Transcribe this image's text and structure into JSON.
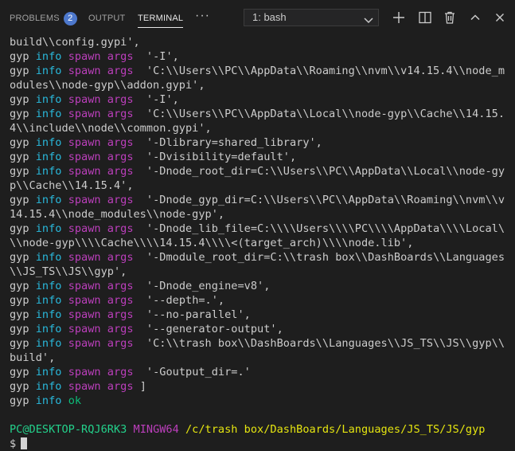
{
  "tabs": {
    "problems": "PROBLEMS",
    "problems_count": "2",
    "output": "OUTPUT",
    "terminal": "TERMINAL",
    "more": "···"
  },
  "terminal_select": {
    "value": "1: bash"
  },
  "icons": [
    "plus-icon",
    "split-icon",
    "trash-icon",
    "chevron-up-icon",
    "close-icon",
    "chevron-down-icon"
  ],
  "colors": {
    "background": "#1e1e1e",
    "info": "#29b8db",
    "spawn_args": "#bc3fbc",
    "ok": "#0dbc79",
    "prompt_user": "#23d18b",
    "prompt_env": "#bc3fbc",
    "prompt_path": "#e5e510",
    "badge": "#4d78cc"
  },
  "lines": [
    {
      "type": "plain",
      "text": "build\\\\config.gypi',"
    },
    {
      "type": "spawn",
      "arg": "  '-I',"
    },
    {
      "type": "spawn",
      "arg": "  'C:\\\\Users\\\\PC\\\\AppData\\\\Roaming\\\\nvm\\\\v14.15.4\\\\node_m"
    },
    {
      "type": "plain",
      "text": "odules\\\\node-gyp\\\\addon.gypi',"
    },
    {
      "type": "spawn",
      "arg": "  '-I',"
    },
    {
      "type": "spawn",
      "arg": "  'C:\\\\Users\\\\PC\\\\AppData\\\\Local\\\\node-gyp\\\\Cache\\\\14.15."
    },
    {
      "type": "plain",
      "text": "4\\\\include\\\\node\\\\common.gypi',"
    },
    {
      "type": "spawn",
      "arg": "  '-Dlibrary=shared_library',"
    },
    {
      "type": "spawn",
      "arg": "  '-Dvisibility=default',"
    },
    {
      "type": "spawn",
      "arg": "  '-Dnode_root_dir=C:\\\\Users\\\\PC\\\\AppData\\\\Local\\\\node-gy"
    },
    {
      "type": "plain",
      "text": "p\\\\Cache\\\\14.15.4',"
    },
    {
      "type": "spawn",
      "arg": "  '-Dnode_gyp_dir=C:\\\\Users\\\\PC\\\\AppData\\\\Roaming\\\\nvm\\\\v"
    },
    {
      "type": "plain",
      "text": "14.15.4\\\\node_modules\\\\node-gyp',"
    },
    {
      "type": "spawn",
      "arg": "  '-Dnode_lib_file=C:\\\\\\\\Users\\\\\\\\PC\\\\\\\\AppData\\\\\\\\Local\\"
    },
    {
      "type": "plain",
      "text": "\\\\node-gyp\\\\\\\\Cache\\\\\\\\14.15.4\\\\\\\\<(target_arch)\\\\\\\\node.lib',"
    },
    {
      "type": "spawn",
      "arg": "  '-Dmodule_root_dir=C:\\\\trash box\\\\DashBoards\\\\Languages"
    },
    {
      "type": "plain",
      "text": "\\\\JS_TS\\\\JS\\\\gyp',"
    },
    {
      "type": "spawn",
      "arg": "  '-Dnode_engine=v8',"
    },
    {
      "type": "spawn",
      "arg": "  '--depth=.',"
    },
    {
      "type": "spawn",
      "arg": "  '--no-parallel',"
    },
    {
      "type": "spawn",
      "arg": "  '--generator-output',"
    },
    {
      "type": "spawn",
      "arg": "  'C:\\\\trash box\\\\DashBoards\\\\Languages\\\\JS_TS\\\\JS\\\\gyp\\\\"
    },
    {
      "type": "plain",
      "text": "build',"
    },
    {
      "type": "spawn",
      "arg": "  '-Goutput_dir=.'"
    },
    {
      "type": "spawn",
      "arg": " ]"
    },
    {
      "type": "ok"
    },
    {
      "type": "blank"
    },
    {
      "type": "prompt"
    }
  ],
  "tokens": {
    "gyp": "gyp",
    "info": "info",
    "spawn_args": "spawn args",
    "ok": "ok"
  },
  "prompt": {
    "user": "PC@DESKTOP-RQJ6RK3",
    "env": "MINGW64",
    "path": "/c/trash box/DashBoards/Languages/JS_TS/JS/gyp",
    "symbol": "$"
  }
}
